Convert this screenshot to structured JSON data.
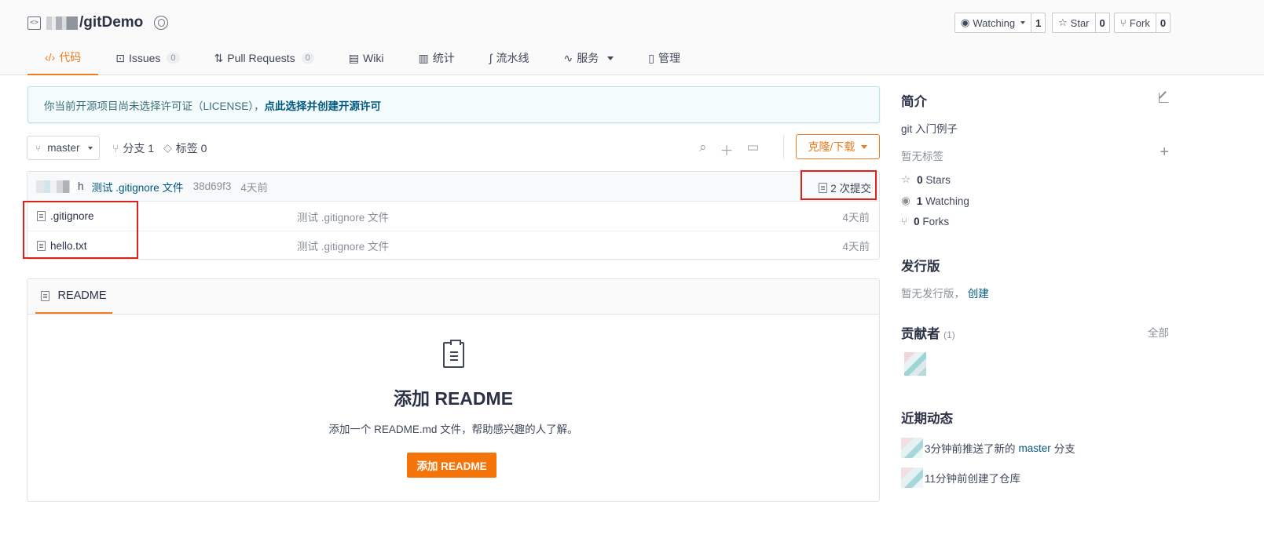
{
  "repo": {
    "name": "/gitDemo"
  },
  "social": {
    "watch_label": "Watching",
    "watch_count": "1",
    "star_label": "Star",
    "star_count": "0",
    "fork_label": "Fork",
    "fork_count": "0"
  },
  "tabs": [
    {
      "label": "代码",
      "icon": "code-icon"
    },
    {
      "label": "Issues",
      "count": "0",
      "icon": "issues-icon"
    },
    {
      "label": "Pull Requests",
      "count": "0",
      "icon": "pull-request-icon"
    },
    {
      "label": "Wiki",
      "icon": "book-icon"
    },
    {
      "label": "统计",
      "icon": "bar-chart-icon"
    },
    {
      "label": "流水线",
      "icon": "pipeline-icon"
    },
    {
      "label": "服务",
      "icon": "pulse-icon"
    },
    {
      "label": "管理",
      "icon": "settings-doc-icon"
    }
  ],
  "notice": {
    "text": "你当前开源项目尚未选择许可证（LICENSE），",
    "link": "点此选择并创建开源许可"
  },
  "toolbar": {
    "branch": "master",
    "branches_label": "分支 1",
    "tags_label": "标签 0",
    "clone_label": "克隆/下载"
  },
  "commit": {
    "author_suffix": "h",
    "message": "测试 .gitignore 文件",
    "hash": "38d69f3",
    "time": "4天前",
    "count_label": "2 次提交"
  },
  "files": [
    {
      "name": ".gitignore",
      "message": "测试 .gitignore 文件",
      "time": "4天前"
    },
    {
      "name": "hello.txt",
      "message": "测试 .gitignore 文件",
      "time": "4天前"
    }
  ],
  "readme": {
    "tab_label": "README",
    "title": "添加 README",
    "desc": "添加一个 README.md 文件，帮助感兴趣的人了解。",
    "button": "添加 README"
  },
  "sidebar": {
    "intro_title": "简介",
    "description": "git 入门例子",
    "no_tags": "暂无标签",
    "stars_count": "0",
    "stars_label": "Stars",
    "watching_count": "1",
    "watching_label": "Watching",
    "forks_count": "0",
    "forks_label": "Forks",
    "releases_title": "发行版",
    "no_releases": "暂无发行版，",
    "create_link": "创建",
    "contributors_title": "贡献者",
    "contributors_count": "(1)",
    "all_link": "全部",
    "activity_title": "近期动态",
    "activity": [
      {
        "prefix": "3分钟前推送了新的 ",
        "branch": "master",
        "suffix": " 分支"
      },
      {
        "prefix": "11分钟前创建了仓库",
        "branch": "",
        "suffix": ""
      }
    ]
  },
  "colors": {
    "accent": "#f17b1f",
    "link": "#005980",
    "highlight": "#e0201b"
  }
}
